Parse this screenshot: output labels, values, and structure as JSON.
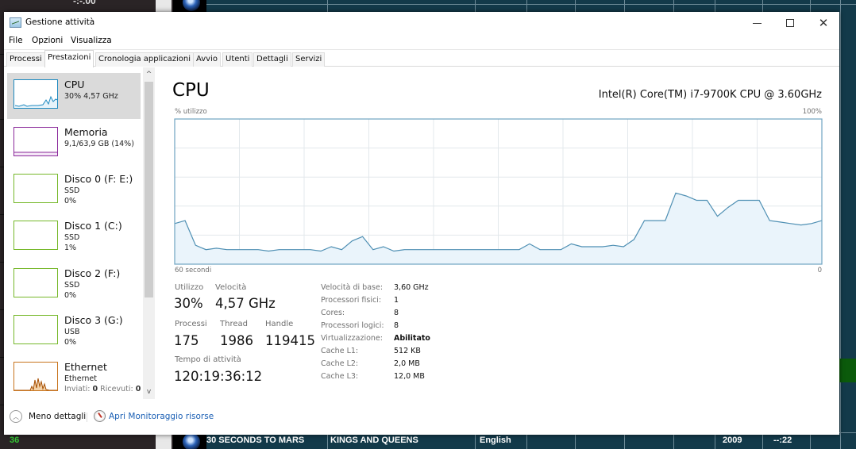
{
  "window": {
    "title": "Gestione attività",
    "controls": {
      "minimize": "minimize",
      "maximize": "maximize",
      "close": "close"
    }
  },
  "menu": [
    "File",
    "Opzioni",
    "Visualizza"
  ],
  "tabs": [
    {
      "label": "Processi",
      "active": false
    },
    {
      "label": "Prestazioni",
      "active": true
    },
    {
      "label": "Cronologia applicazioni",
      "active": false
    },
    {
      "label": "Avvio",
      "active": false
    },
    {
      "label": "Utenti",
      "active": false
    },
    {
      "label": "Dettagli",
      "active": false
    },
    {
      "label": "Servizi",
      "active": false
    }
  ],
  "sidebar": {
    "items": [
      {
        "title": "CPU",
        "sub1": "30% 4,57 GHz",
        "sub2": "",
        "color": "#1f8ac0",
        "selected": true
      },
      {
        "title": "Memoria",
        "sub1": "9,1/63,9 GB (14%)",
        "sub2": "",
        "color": "#8b2a9b",
        "selected": false
      },
      {
        "title": "Disco 0 (F: E:)",
        "sub1": "SSD",
        "sub2": "0%",
        "color": "#4da60c",
        "selected": false
      },
      {
        "title": "Disco 1 (C:)",
        "sub1": "SSD",
        "sub2": "1%",
        "color": "#4da60c",
        "selected": false
      },
      {
        "title": "Disco 2 (F:)",
        "sub1": "SSD",
        "sub2": "0%",
        "color": "#4da60c",
        "selected": false
      },
      {
        "title": "Disco 3 (G:)",
        "sub1": "USB",
        "sub2": "0%",
        "color": "#4da60c",
        "selected": false
      },
      {
        "title": "Ethernet",
        "sub1": "Ethernet",
        "sub2_label1": "Inviati:",
        "sub2_value1": "0",
        "sub2_label2": "Ricevuti:",
        "sub2_value2": "0 I",
        "color": "#a74f01",
        "selected": false
      }
    ],
    "scroll_up": "^",
    "scroll_down": "v"
  },
  "main": {
    "title": "CPU",
    "cpu_model": "Intel(R) Core(TM) i7-9700K CPU @ 3.60GHz",
    "y_axis_label": "% utilizzo",
    "y_max_label": "100%",
    "x_left_label": "60 secondi",
    "x_right_label": "0",
    "stats": {
      "utilizzo_label": "Utilizzo",
      "utilizzo_value": "30%",
      "velocita_label": "Velocità",
      "velocita_value": "4,57 GHz",
      "processi_label": "Processi",
      "processi_value": "175",
      "thread_label": "Thread",
      "thread_value": "1986",
      "handle_label": "Handle",
      "handle_value": "119415",
      "uptime_label": "Tempo di attività",
      "uptime_value": "120:19:36:12"
    },
    "info": [
      {
        "label": "Velocità di base:",
        "value": "3,60 GHz",
        "bold": false
      },
      {
        "label": "Processori fisici:",
        "value": "1",
        "bold": false
      },
      {
        "label": "Cores:",
        "value": "8",
        "bold": false
      },
      {
        "label": "Processori logici:",
        "value": "8",
        "bold": false
      },
      {
        "label": "Virtualizzazione:",
        "value": "Abilitato",
        "bold": true
      },
      {
        "label": "Cache L1:",
        "value": "512 KB",
        "bold": false
      },
      {
        "label": "Cache L2:",
        "value": "2,0 MB",
        "bold": false
      },
      {
        "label": "Cache L3:",
        "value": "12,0 MB",
        "bold": false
      }
    ]
  },
  "footer": {
    "fewer_details": "Meno dettagli",
    "resource_monitor": "Apri Monitoraggio risorse"
  },
  "background_app": {
    "top_text": "-:-.00",
    "row_number": "36",
    "track": {
      "artist": "30 SECONDS TO MARS",
      "title": "KINGS AND QUEENS",
      "language": "English",
      "year": "2009",
      "duration": "--:22"
    }
  },
  "chart_data": {
    "type": "area",
    "title": "CPU % utilizzo",
    "xlabel": "60 secondi",
    "ylabel": "% utilizzo",
    "ylim": [
      0,
      100
    ],
    "xlim": [
      60,
      0
    ],
    "grid": true,
    "grid_rows": 5,
    "grid_cols": 10,
    "line_color": "#4e8fb3",
    "fill_color": "#eaf4fb",
    "values": [
      28,
      30,
      13,
      10,
      11,
      10,
      10,
      10,
      10,
      9,
      10,
      10,
      10,
      10,
      9,
      12,
      10,
      16,
      19,
      10,
      12,
      9,
      10,
      10,
      10,
      10,
      10,
      10,
      10,
      10,
      10,
      10,
      10,
      10,
      14,
      10,
      10,
      10,
      14,
      12,
      12,
      12,
      13,
      12,
      17,
      30,
      30,
      30,
      49,
      47,
      44,
      44,
      33,
      39,
      44,
      44,
      44,
      30,
      29,
      28,
      27,
      28,
      30
    ]
  }
}
